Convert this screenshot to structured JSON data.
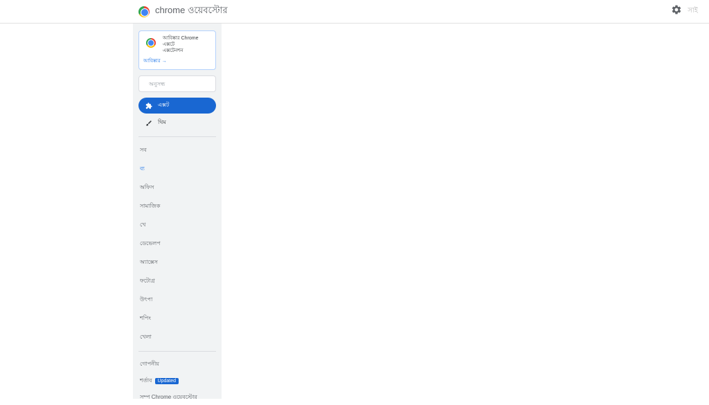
{
  "header": {
    "title": "chrome ওয়েবস্টোর",
    "user_label": "সাই"
  },
  "promo": {
    "line1": "আবিষ্কার Chrome এক্সটে",
    "line2": "এক্সটেনশন",
    "link": "আবিষ্কার →"
  },
  "search": {
    "placeholder": "অনুসন্ধ"
  },
  "nav": {
    "extensions": "এক্সট",
    "themes": "থিম"
  },
  "categories": [
    "সব",
    "ব্য",
    "অফিস",
    "সামাজিক",
    "খে",
    "ডেভেলপ",
    "অ্যাক্সেস",
    "ফটোগ্র",
    "উৎপা",
    "শপিং",
    "খেলা"
  ],
  "footer": {
    "privacy": "গোপনীয়",
    "terms": "শর্তাব",
    "terms_badge": "Updated",
    "about": "সম্প Chrome ওয়েবস্টোর"
  }
}
